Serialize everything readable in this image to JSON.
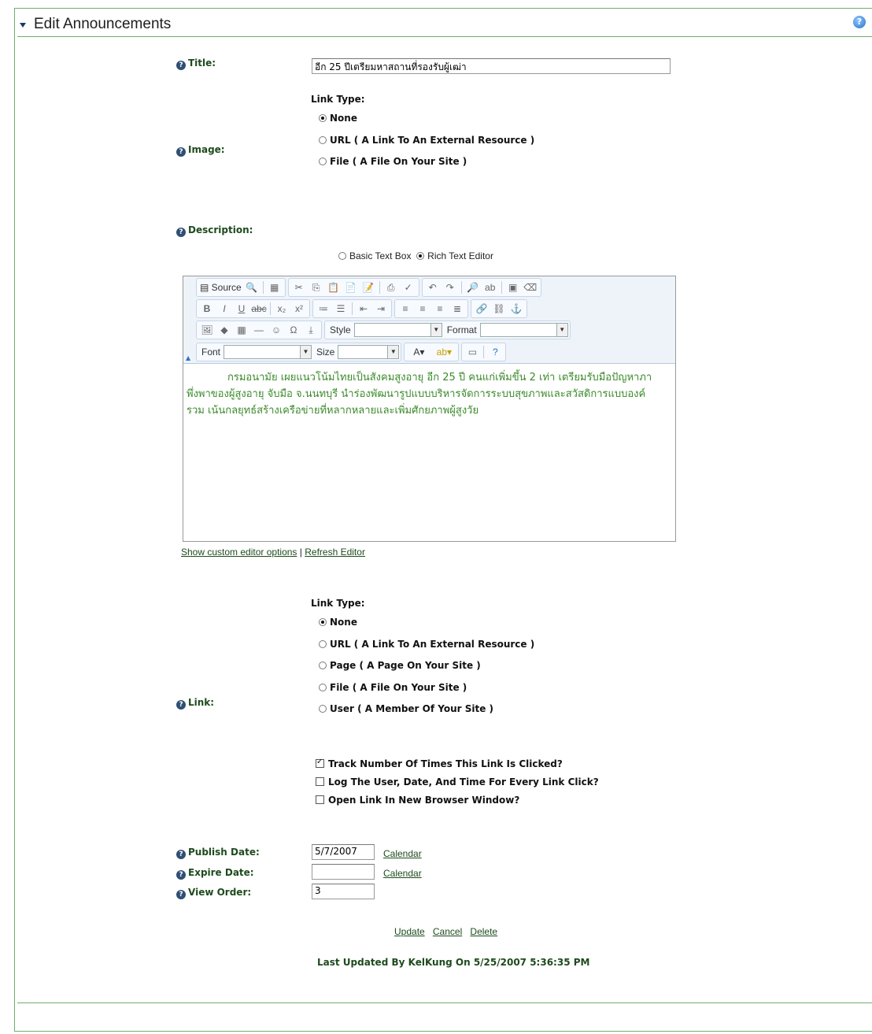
{
  "header": {
    "title": "Edit Announcements"
  },
  "title_field": {
    "label": "Title:",
    "value": "อีก 25 ปีเตรียมหาสถานที่รองรับผู้เฒ่า"
  },
  "image_field": {
    "label": "Image:",
    "link_type_label": "Link Type:",
    "options": [
      "None",
      "URL ( A Link To An External Resource )",
      "File ( A File On Your Site )"
    ],
    "selected": "None"
  },
  "description": {
    "label": "Description:",
    "mode_options": [
      "Basic Text Box",
      "Rich Text Editor"
    ],
    "selected_mode": "Rich Text Editor",
    "toolbar": {
      "source": "Source",
      "style": "Style",
      "format": "Format",
      "font": "Font",
      "size": "Size"
    },
    "content": "กรมอนามัย เผยแนวโน้มไทยเป็นสังคมสูงอายุ อีก 25 ปี คนแก่เพิ่มขึ้น 2 เท่า เตรียมรับมือปัญหาภาพึ่งพาของผู้สูงอายุ จับมือ จ.นนทบุรี นำร่องพัฒนารูปแบบบริหารจัดการระบบสุขภาพและสวัสดิการแบบองค์รวม เน้นกลยุทธ์สร้างเครือข่ายที่หลากหลายและเพิ่มศักยภาพผู้สูงวัย",
    "links": {
      "show_options": "Show custom editor options",
      "separator": "|",
      "refresh": "Refresh Editor"
    }
  },
  "link_field": {
    "label": "Link:",
    "link_type_label": "Link Type:",
    "options": [
      "None",
      "URL ( A Link To An External Resource )",
      "Page ( A Page On Your Site )",
      "File ( A File On Your Site )",
      "User ( A Member Of Your Site )"
    ],
    "selected": "None",
    "checkboxes": [
      {
        "label": "Track Number Of Times This Link Is Clicked?",
        "checked": true
      },
      {
        "label": "Log The User, Date, And Time For Every Link Click?",
        "checked": false
      },
      {
        "label": "Open Link In New Browser Window?",
        "checked": false
      }
    ]
  },
  "publish_date": {
    "label": "Publish Date:",
    "value": "5/7/2007",
    "calendar": "Calendar"
  },
  "expire_date": {
    "label": "Expire Date:",
    "value": "",
    "calendar": "Calendar"
  },
  "view_order": {
    "label": "View Order:",
    "value": "3"
  },
  "actions": {
    "update": "Update",
    "cancel": "Cancel",
    "delete": "Delete"
  },
  "footer": {
    "last_updated": "Last Updated By KelKung On 5/25/2007 5:36:35 PM"
  }
}
